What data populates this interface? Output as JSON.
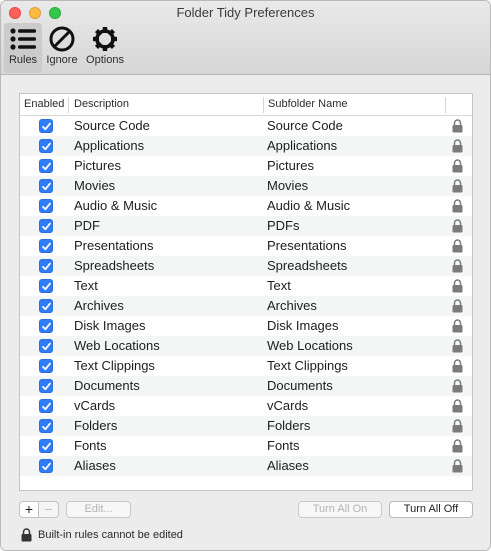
{
  "window": {
    "title": "Folder Tidy Preferences"
  },
  "toolbar": {
    "rules_label": "Rules",
    "ignore_label": "Ignore",
    "options_label": "Options"
  },
  "table": {
    "headers": {
      "enabled": "Enabled",
      "description": "Description",
      "subfolder": "Subfolder Name"
    },
    "rows": [
      {
        "enabled": true,
        "description": "Source Code",
        "subfolder": "Source Code",
        "locked": true
      },
      {
        "enabled": true,
        "description": "Applications",
        "subfolder": "Applications",
        "locked": true
      },
      {
        "enabled": true,
        "description": "Pictures",
        "subfolder": "Pictures",
        "locked": true
      },
      {
        "enabled": true,
        "description": "Movies",
        "subfolder": "Movies",
        "locked": true
      },
      {
        "enabled": true,
        "description": "Audio & Music",
        "subfolder": "Audio & Music",
        "locked": true
      },
      {
        "enabled": true,
        "description": "PDF",
        "subfolder": "PDFs",
        "locked": true
      },
      {
        "enabled": true,
        "description": "Presentations",
        "subfolder": "Presentations",
        "locked": true
      },
      {
        "enabled": true,
        "description": "Spreadsheets",
        "subfolder": "Spreadsheets",
        "locked": true
      },
      {
        "enabled": true,
        "description": "Text",
        "subfolder": "Text",
        "locked": true
      },
      {
        "enabled": true,
        "description": "Archives",
        "subfolder": "Archives",
        "locked": true
      },
      {
        "enabled": true,
        "description": "Disk Images",
        "subfolder": "Disk Images",
        "locked": true
      },
      {
        "enabled": true,
        "description": "Web Locations",
        "subfolder": "Web Locations",
        "locked": true
      },
      {
        "enabled": true,
        "description": "Text Clippings",
        "subfolder": "Text Clippings",
        "locked": true
      },
      {
        "enabled": true,
        "description": "Documents",
        "subfolder": "Documents",
        "locked": true
      },
      {
        "enabled": true,
        "description": "vCards",
        "subfolder": "vCards",
        "locked": true
      },
      {
        "enabled": true,
        "description": "Folders",
        "subfolder": "Folders",
        "locked": true
      },
      {
        "enabled": true,
        "description": "Fonts",
        "subfolder": "Fonts",
        "locked": true
      },
      {
        "enabled": true,
        "description": "Aliases",
        "subfolder": "Aliases",
        "locked": true
      }
    ]
  },
  "buttons": {
    "add": "+",
    "remove": "−",
    "edit": "Edit...",
    "turn_all_on": "Turn All On",
    "turn_all_off": "Turn All Off"
  },
  "footer": {
    "note": "Built-in rules cannot be edited"
  },
  "colors": {
    "checkbox_accent": "#2f7cf6",
    "selected_toolbar": "#cbcbcb"
  }
}
